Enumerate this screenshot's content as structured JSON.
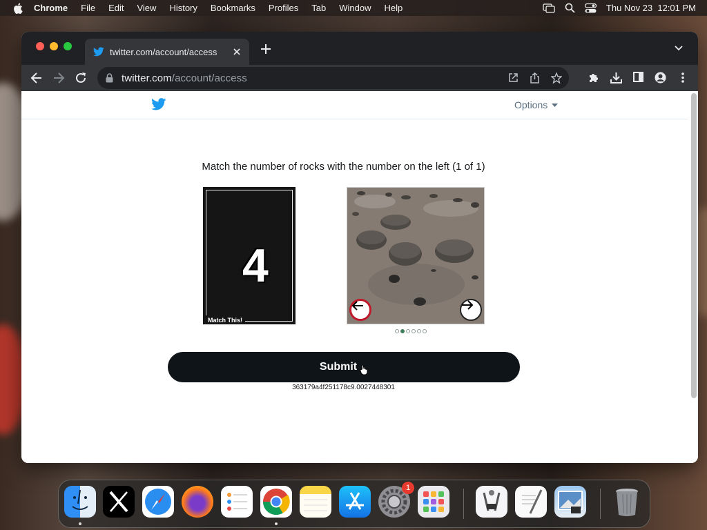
{
  "menubar": {
    "app_name": "Chrome",
    "items": [
      "File",
      "Edit",
      "View",
      "History",
      "Bookmarks",
      "Profiles",
      "Tab",
      "Window",
      "Help"
    ],
    "clock": "Thu Nov 23  12:01 PM"
  },
  "browser": {
    "tab_title": "twitter.com/account/access",
    "url_host": "twitter.com",
    "url_path": "/account/access"
  },
  "page": {
    "options_label": "Options",
    "instruction": "Match the number of rocks with the number on the left (1 of 1)",
    "match_number": "4",
    "match_caption": "Match This!",
    "image_index": 2,
    "image_count": 6,
    "submit_label": "Submit",
    "session_id": "363179a4f251178c9.0027448301"
  },
  "dock": {
    "apps": [
      "Finder",
      "X",
      "Safari",
      "Firefox",
      "Reminders",
      "Chrome",
      "Notes",
      "App Store",
      "System Settings",
      "Launchpad",
      "Digital Color Meter",
      "TextEdit",
      "Preview",
      "Trash"
    ],
    "settings_badge": "1"
  },
  "colors": {
    "twitter_blue": "#1d9bf0",
    "submit_bg": "#0f1419",
    "active_dot": "#3e7d5a",
    "prev_border": "#c0182b"
  }
}
